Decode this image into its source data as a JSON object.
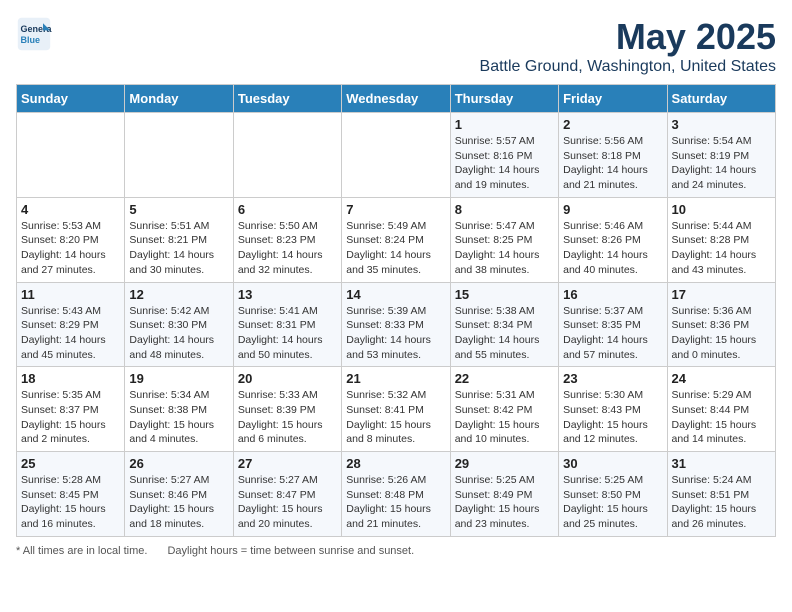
{
  "header": {
    "logo_line1": "General",
    "logo_line2": "Blue",
    "month": "May 2025",
    "location": "Battle Ground, Washington, United States"
  },
  "days_of_week": [
    "Sunday",
    "Monday",
    "Tuesday",
    "Wednesday",
    "Thursday",
    "Friday",
    "Saturday"
  ],
  "weeks": [
    [
      {
        "day": "",
        "info": ""
      },
      {
        "day": "",
        "info": ""
      },
      {
        "day": "",
        "info": ""
      },
      {
        "day": "",
        "info": ""
      },
      {
        "day": "1",
        "info": "Sunrise: 5:57 AM\nSunset: 8:16 PM\nDaylight: 14 hours\nand 19 minutes."
      },
      {
        "day": "2",
        "info": "Sunrise: 5:56 AM\nSunset: 8:18 PM\nDaylight: 14 hours\nand 21 minutes."
      },
      {
        "day": "3",
        "info": "Sunrise: 5:54 AM\nSunset: 8:19 PM\nDaylight: 14 hours\nand 24 minutes."
      }
    ],
    [
      {
        "day": "4",
        "info": "Sunrise: 5:53 AM\nSunset: 8:20 PM\nDaylight: 14 hours\nand 27 minutes."
      },
      {
        "day": "5",
        "info": "Sunrise: 5:51 AM\nSunset: 8:21 PM\nDaylight: 14 hours\nand 30 minutes."
      },
      {
        "day": "6",
        "info": "Sunrise: 5:50 AM\nSunset: 8:23 PM\nDaylight: 14 hours\nand 32 minutes."
      },
      {
        "day": "7",
        "info": "Sunrise: 5:49 AM\nSunset: 8:24 PM\nDaylight: 14 hours\nand 35 minutes."
      },
      {
        "day": "8",
        "info": "Sunrise: 5:47 AM\nSunset: 8:25 PM\nDaylight: 14 hours\nand 38 minutes."
      },
      {
        "day": "9",
        "info": "Sunrise: 5:46 AM\nSunset: 8:26 PM\nDaylight: 14 hours\nand 40 minutes."
      },
      {
        "day": "10",
        "info": "Sunrise: 5:44 AM\nSunset: 8:28 PM\nDaylight: 14 hours\nand 43 minutes."
      }
    ],
    [
      {
        "day": "11",
        "info": "Sunrise: 5:43 AM\nSunset: 8:29 PM\nDaylight: 14 hours\nand 45 minutes."
      },
      {
        "day": "12",
        "info": "Sunrise: 5:42 AM\nSunset: 8:30 PM\nDaylight: 14 hours\nand 48 minutes."
      },
      {
        "day": "13",
        "info": "Sunrise: 5:41 AM\nSunset: 8:31 PM\nDaylight: 14 hours\nand 50 minutes."
      },
      {
        "day": "14",
        "info": "Sunrise: 5:39 AM\nSunset: 8:33 PM\nDaylight: 14 hours\nand 53 minutes."
      },
      {
        "day": "15",
        "info": "Sunrise: 5:38 AM\nSunset: 8:34 PM\nDaylight: 14 hours\nand 55 minutes."
      },
      {
        "day": "16",
        "info": "Sunrise: 5:37 AM\nSunset: 8:35 PM\nDaylight: 14 hours\nand 57 minutes."
      },
      {
        "day": "17",
        "info": "Sunrise: 5:36 AM\nSunset: 8:36 PM\nDaylight: 15 hours\nand 0 minutes."
      }
    ],
    [
      {
        "day": "18",
        "info": "Sunrise: 5:35 AM\nSunset: 8:37 PM\nDaylight: 15 hours\nand 2 minutes."
      },
      {
        "day": "19",
        "info": "Sunrise: 5:34 AM\nSunset: 8:38 PM\nDaylight: 15 hours\nand 4 minutes."
      },
      {
        "day": "20",
        "info": "Sunrise: 5:33 AM\nSunset: 8:39 PM\nDaylight: 15 hours\nand 6 minutes."
      },
      {
        "day": "21",
        "info": "Sunrise: 5:32 AM\nSunset: 8:41 PM\nDaylight: 15 hours\nand 8 minutes."
      },
      {
        "day": "22",
        "info": "Sunrise: 5:31 AM\nSunset: 8:42 PM\nDaylight: 15 hours\nand 10 minutes."
      },
      {
        "day": "23",
        "info": "Sunrise: 5:30 AM\nSunset: 8:43 PM\nDaylight: 15 hours\nand 12 minutes."
      },
      {
        "day": "24",
        "info": "Sunrise: 5:29 AM\nSunset: 8:44 PM\nDaylight: 15 hours\nand 14 minutes."
      }
    ],
    [
      {
        "day": "25",
        "info": "Sunrise: 5:28 AM\nSunset: 8:45 PM\nDaylight: 15 hours\nand 16 minutes."
      },
      {
        "day": "26",
        "info": "Sunrise: 5:27 AM\nSunset: 8:46 PM\nDaylight: 15 hours\nand 18 minutes."
      },
      {
        "day": "27",
        "info": "Sunrise: 5:27 AM\nSunset: 8:47 PM\nDaylight: 15 hours\nand 20 minutes."
      },
      {
        "day": "28",
        "info": "Sunrise: 5:26 AM\nSunset: 8:48 PM\nDaylight: 15 hours\nand 21 minutes."
      },
      {
        "day": "29",
        "info": "Sunrise: 5:25 AM\nSunset: 8:49 PM\nDaylight: 15 hours\nand 23 minutes."
      },
      {
        "day": "30",
        "info": "Sunrise: 5:25 AM\nSunset: 8:50 PM\nDaylight: 15 hours\nand 25 minutes."
      },
      {
        "day": "31",
        "info": "Sunrise: 5:24 AM\nSunset: 8:51 PM\nDaylight: 15 hours\nand 26 minutes."
      }
    ]
  ],
  "footer": {
    "note1": "* All times are in local time.",
    "note2": "Daylight hours = time between sunrise and sunset."
  }
}
